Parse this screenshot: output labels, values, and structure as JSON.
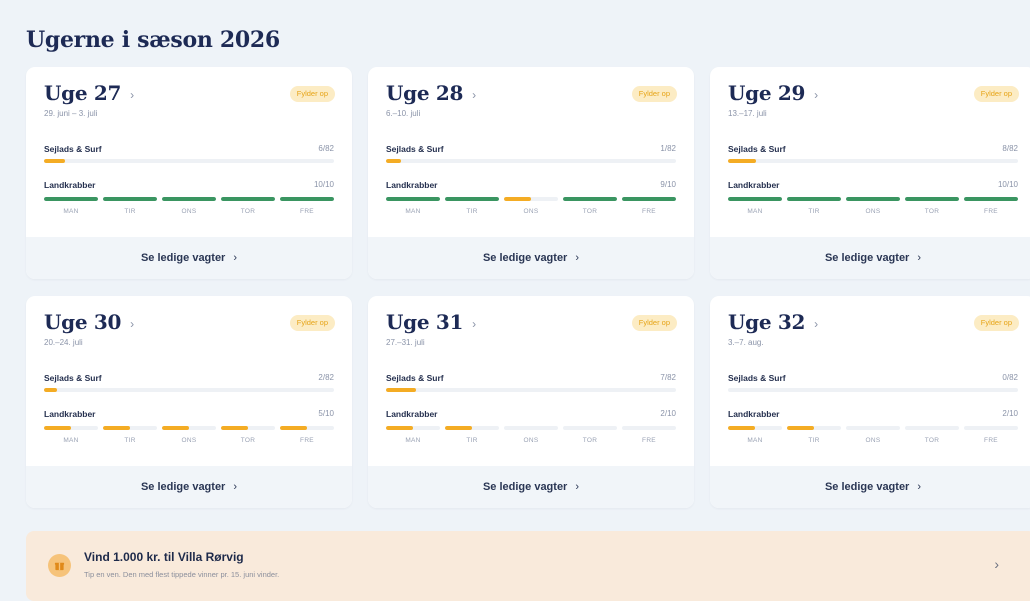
{
  "page": {
    "title": "Ugerne i sæson 2026"
  },
  "colors": {
    "accent_green": "#3a9561",
    "accent_orange": "#f4ac24",
    "badge_bg": "#fcecc4",
    "badge_text": "#e6a417",
    "navy": "#1d2a55"
  },
  "icons": {
    "week_chevron": "chevron-right-icon",
    "promo_icon": "gift-icon"
  },
  "weeks": [
    {
      "title": "Uge 27",
      "dates": "29. juni – 3. juli",
      "badge": "Fylder op",
      "surf": {
        "label": "Sejlads & Surf",
        "count": "6/82",
        "fraction": 0.073
      },
      "land": {
        "label": "Landkrabber",
        "count": "10/10",
        "days": [
          {
            "name": "MAN",
            "fill": 1.0,
            "status": "full"
          },
          {
            "name": "TIR",
            "fill": 1.0,
            "status": "full"
          },
          {
            "name": "ONS",
            "fill": 1.0,
            "status": "full"
          },
          {
            "name": "TOR",
            "fill": 1.0,
            "status": "full"
          },
          {
            "name": "FRE",
            "fill": 1.0,
            "status": "full"
          }
        ]
      },
      "cta": "Se ledige vagter"
    },
    {
      "title": "Uge 28",
      "dates": "6.–10. juli",
      "badge": "Fylder op",
      "surf": {
        "label": "Sejlads & Surf",
        "count": "1/82",
        "fraction": 0.05
      },
      "land": {
        "label": "Landkrabber",
        "count": "9/10",
        "days": [
          {
            "name": "MAN",
            "fill": 1.0,
            "status": "full"
          },
          {
            "name": "TIR",
            "fill": 1.0,
            "status": "full"
          },
          {
            "name": "ONS",
            "fill": 0.5,
            "status": "partial"
          },
          {
            "name": "TOR",
            "fill": 1.0,
            "status": "full"
          },
          {
            "name": "FRE",
            "fill": 1.0,
            "status": "full"
          }
        ]
      },
      "cta": "Se ledige vagter"
    },
    {
      "title": "Uge 29",
      "dates": "13.–17. juli",
      "badge": "Fylder op",
      "surf": {
        "label": "Sejlads & Surf",
        "count": "8/82",
        "fraction": 0.098
      },
      "land": {
        "label": "Landkrabber",
        "count": "10/10",
        "days": [
          {
            "name": "MAN",
            "fill": 1.0,
            "status": "full"
          },
          {
            "name": "TIR",
            "fill": 1.0,
            "status": "full"
          },
          {
            "name": "ONS",
            "fill": 1.0,
            "status": "full"
          },
          {
            "name": "TOR",
            "fill": 1.0,
            "status": "full"
          },
          {
            "name": "FRE",
            "fill": 1.0,
            "status": "full"
          }
        ]
      },
      "cta": "Se ledige vagter"
    },
    {
      "title": "Uge 30",
      "dates": "20.–24. juli",
      "badge": "Fylder op",
      "surf": {
        "label": "Sejlads & Surf",
        "count": "2/82",
        "fraction": 0.045
      },
      "land": {
        "label": "Landkrabber",
        "count": "5/10",
        "days": [
          {
            "name": "MAN",
            "fill": 0.5,
            "status": "partial"
          },
          {
            "name": "TIR",
            "fill": 0.5,
            "status": "partial"
          },
          {
            "name": "ONS",
            "fill": 0.5,
            "status": "partial"
          },
          {
            "name": "TOR",
            "fill": 0.5,
            "status": "partial"
          },
          {
            "name": "FRE",
            "fill": 0.5,
            "status": "partial"
          }
        ]
      },
      "cta": "Se ledige vagter"
    },
    {
      "title": "Uge 31",
      "dates": "27.–31. juli",
      "badge": "Fylder op",
      "surf": {
        "label": "Sejlads & Surf",
        "count": "7/82",
        "fraction": 0.105
      },
      "land": {
        "label": "Landkrabber",
        "count": "2/10",
        "days": [
          {
            "name": "MAN",
            "fill": 0.5,
            "status": "partial"
          },
          {
            "name": "TIR",
            "fill": 0.5,
            "status": "partial"
          },
          {
            "name": "ONS",
            "fill": 0.0,
            "status": "empty"
          },
          {
            "name": "TOR",
            "fill": 0.0,
            "status": "empty"
          },
          {
            "name": "FRE",
            "fill": 0.0,
            "status": "empty"
          }
        ]
      },
      "cta": "Se ledige vagter"
    },
    {
      "title": "Uge 32",
      "dates": "3.–7. aug.",
      "badge": "Fylder op",
      "surf": {
        "label": "Sejlads & Surf",
        "count": "0/82",
        "fraction": 0.0
      },
      "land": {
        "label": "Landkrabber",
        "count": "2/10",
        "days": [
          {
            "name": "MAN",
            "fill": 0.5,
            "status": "partial"
          },
          {
            "name": "TIR",
            "fill": 0.5,
            "status": "partial"
          },
          {
            "name": "ONS",
            "fill": 0.0,
            "status": "empty"
          },
          {
            "name": "TOR",
            "fill": 0.0,
            "status": "empty"
          },
          {
            "name": "FRE",
            "fill": 0.0,
            "status": "empty"
          }
        ]
      },
      "cta": "Se ledige vagter"
    }
  ],
  "promo": {
    "title": "Vind 1.000 kr. til Villa Rørvig",
    "subtitle": "Tip en ven. Den med flest tippede vinner pr. 15. juni vinder."
  }
}
